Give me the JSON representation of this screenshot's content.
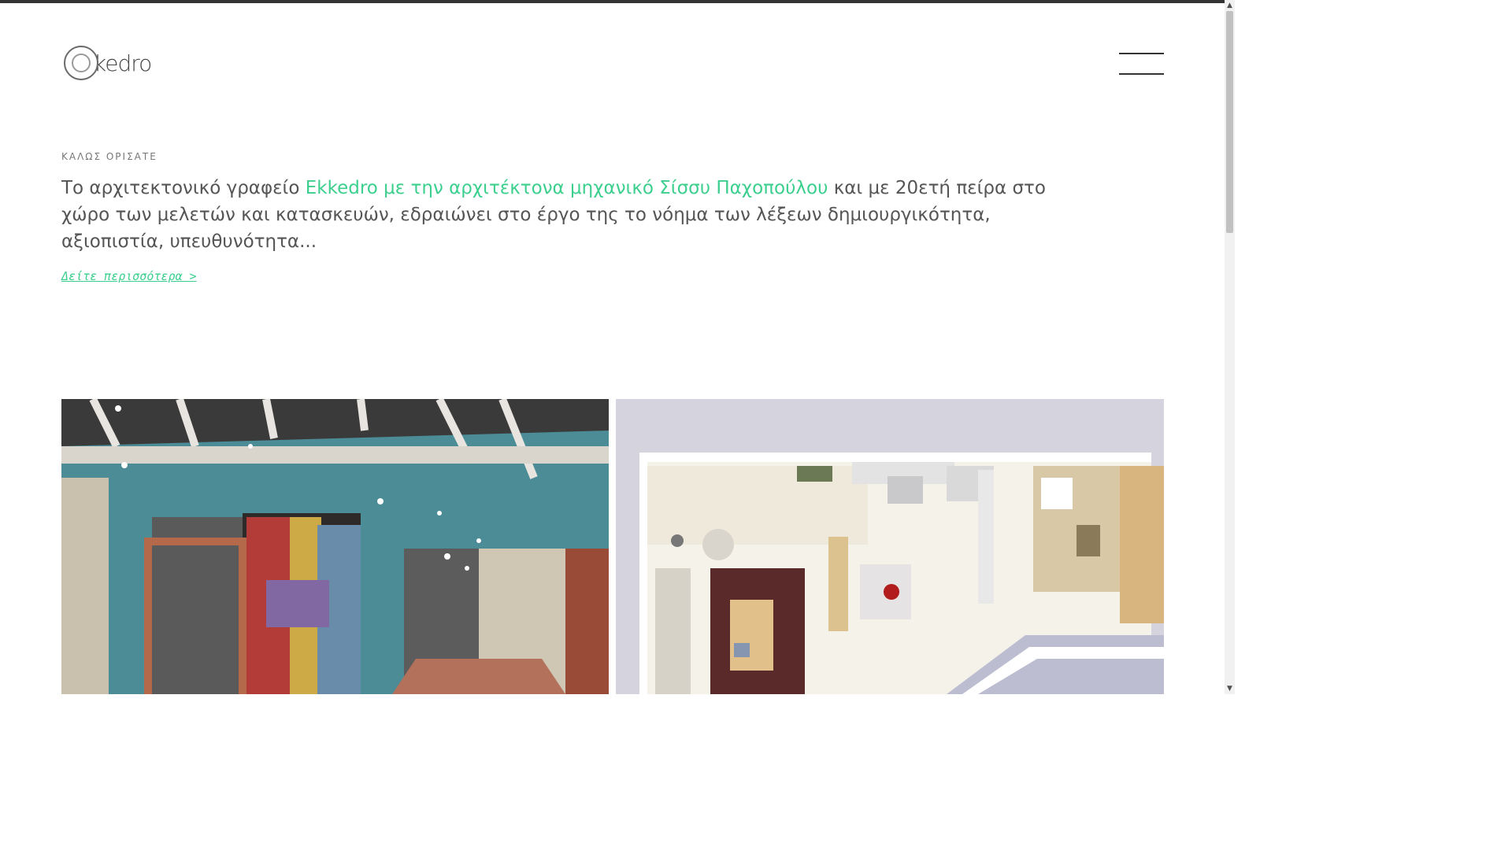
{
  "header": {
    "logo_text": "kedro",
    "menu_icon": "hamburger-menu-icon"
  },
  "welcome": {
    "eyebrow": "ΚΑΛΩΣ ΟΡΙΣΑΤΕ",
    "intro_before": "Το αρχιτεκτονικό γραφείο ",
    "intro_accent": "Ekkedro με την αρχιτέκτονα μηχανικό Σίσσυ Παχοπούλου",
    "intro_after": " και με 20ετή πείρα στο χώρο των μελετών και κατασκευών, εδραιώνει στο έργο της το νόημα των λέξεων δημιουργικότητα, αξιοπιστία, υπευθυνότητα...",
    "more_link": "Δείτε περισσότερα >"
  },
  "gallery": {
    "left_image": "restaurant-interior-render",
    "right_image": "apartment-floor-plan-render"
  },
  "colors": {
    "accent": "#3ccf8e",
    "text": "#555555",
    "dark": "#333333"
  }
}
